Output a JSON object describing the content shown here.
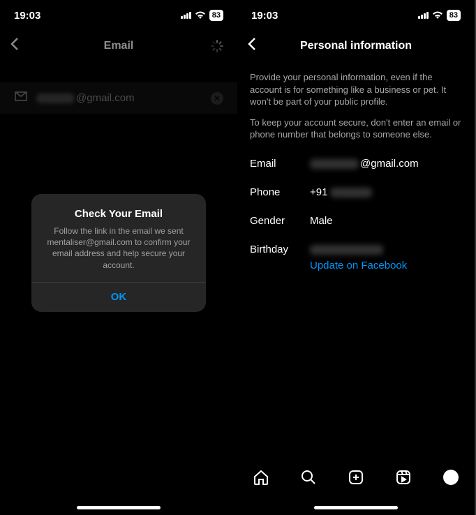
{
  "statusBar": {
    "time": "19:03",
    "battery": "83"
  },
  "left": {
    "headerTitle": "Email",
    "emailValue": "@gmail.com",
    "modal": {
      "title": "Check Your Email",
      "body": "Follow the link in the email we sent mentaliser@gmail.com to confirm your email address and help secure your account.",
      "ok": "OK"
    }
  },
  "right": {
    "headerTitle": "Personal information",
    "info1": "Provide your personal information, even if the account is for something like a business or pet. It won't be part of your public profile.",
    "info2": "To keep your account secure, don't enter an email or phone number that belongs to someone else.",
    "rows": {
      "emailLabel": "Email",
      "emailValue": "@gmail.com",
      "phoneLabel": "Phone",
      "phoneValue": "+91",
      "genderLabel": "Gender",
      "genderValue": "Male",
      "birthdayLabel": "Birthday",
      "fbLink": "Update on Facebook"
    }
  }
}
